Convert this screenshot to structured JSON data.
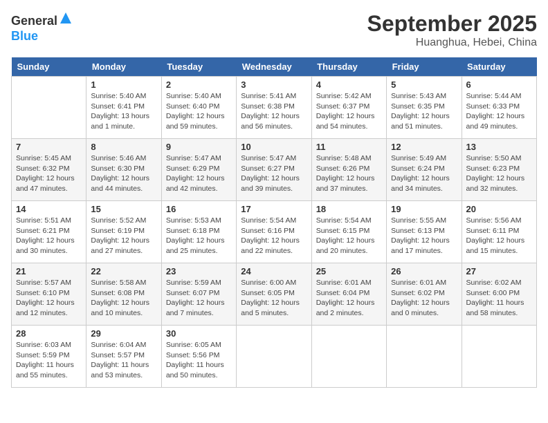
{
  "header": {
    "logo_general": "General",
    "logo_blue": "Blue",
    "month_title": "September 2025",
    "location": "Huanghua, Hebei, China"
  },
  "weekdays": [
    "Sunday",
    "Monday",
    "Tuesday",
    "Wednesday",
    "Thursday",
    "Friday",
    "Saturday"
  ],
  "weeks": [
    [
      {
        "day": "",
        "sunrise": "",
        "sunset": "",
        "daylight": ""
      },
      {
        "day": "1",
        "sunrise": "Sunrise: 5:40 AM",
        "sunset": "Sunset: 6:41 PM",
        "daylight": "Daylight: 13 hours and 1 minute."
      },
      {
        "day": "2",
        "sunrise": "Sunrise: 5:40 AM",
        "sunset": "Sunset: 6:40 PM",
        "daylight": "Daylight: 12 hours and 59 minutes."
      },
      {
        "day": "3",
        "sunrise": "Sunrise: 5:41 AM",
        "sunset": "Sunset: 6:38 PM",
        "daylight": "Daylight: 12 hours and 56 minutes."
      },
      {
        "day": "4",
        "sunrise": "Sunrise: 5:42 AM",
        "sunset": "Sunset: 6:37 PM",
        "daylight": "Daylight: 12 hours and 54 minutes."
      },
      {
        "day": "5",
        "sunrise": "Sunrise: 5:43 AM",
        "sunset": "Sunset: 6:35 PM",
        "daylight": "Daylight: 12 hours and 51 minutes."
      },
      {
        "day": "6",
        "sunrise": "Sunrise: 5:44 AM",
        "sunset": "Sunset: 6:33 PM",
        "daylight": "Daylight: 12 hours and 49 minutes."
      }
    ],
    [
      {
        "day": "7",
        "sunrise": "Sunrise: 5:45 AM",
        "sunset": "Sunset: 6:32 PM",
        "daylight": "Daylight: 12 hours and 47 minutes."
      },
      {
        "day": "8",
        "sunrise": "Sunrise: 5:46 AM",
        "sunset": "Sunset: 6:30 PM",
        "daylight": "Daylight: 12 hours and 44 minutes."
      },
      {
        "day": "9",
        "sunrise": "Sunrise: 5:47 AM",
        "sunset": "Sunset: 6:29 PM",
        "daylight": "Daylight: 12 hours and 42 minutes."
      },
      {
        "day": "10",
        "sunrise": "Sunrise: 5:47 AM",
        "sunset": "Sunset: 6:27 PM",
        "daylight": "Daylight: 12 hours and 39 minutes."
      },
      {
        "day": "11",
        "sunrise": "Sunrise: 5:48 AM",
        "sunset": "Sunset: 6:26 PM",
        "daylight": "Daylight: 12 hours and 37 minutes."
      },
      {
        "day": "12",
        "sunrise": "Sunrise: 5:49 AM",
        "sunset": "Sunset: 6:24 PM",
        "daylight": "Daylight: 12 hours and 34 minutes."
      },
      {
        "day": "13",
        "sunrise": "Sunrise: 5:50 AM",
        "sunset": "Sunset: 6:23 PM",
        "daylight": "Daylight: 12 hours and 32 minutes."
      }
    ],
    [
      {
        "day": "14",
        "sunrise": "Sunrise: 5:51 AM",
        "sunset": "Sunset: 6:21 PM",
        "daylight": "Daylight: 12 hours and 30 minutes."
      },
      {
        "day": "15",
        "sunrise": "Sunrise: 5:52 AM",
        "sunset": "Sunset: 6:19 PM",
        "daylight": "Daylight: 12 hours and 27 minutes."
      },
      {
        "day": "16",
        "sunrise": "Sunrise: 5:53 AM",
        "sunset": "Sunset: 6:18 PM",
        "daylight": "Daylight: 12 hours and 25 minutes."
      },
      {
        "day": "17",
        "sunrise": "Sunrise: 5:54 AM",
        "sunset": "Sunset: 6:16 PM",
        "daylight": "Daylight: 12 hours and 22 minutes."
      },
      {
        "day": "18",
        "sunrise": "Sunrise: 5:54 AM",
        "sunset": "Sunset: 6:15 PM",
        "daylight": "Daylight: 12 hours and 20 minutes."
      },
      {
        "day": "19",
        "sunrise": "Sunrise: 5:55 AM",
        "sunset": "Sunset: 6:13 PM",
        "daylight": "Daylight: 12 hours and 17 minutes."
      },
      {
        "day": "20",
        "sunrise": "Sunrise: 5:56 AM",
        "sunset": "Sunset: 6:11 PM",
        "daylight": "Daylight: 12 hours and 15 minutes."
      }
    ],
    [
      {
        "day": "21",
        "sunrise": "Sunrise: 5:57 AM",
        "sunset": "Sunset: 6:10 PM",
        "daylight": "Daylight: 12 hours and 12 minutes."
      },
      {
        "day": "22",
        "sunrise": "Sunrise: 5:58 AM",
        "sunset": "Sunset: 6:08 PM",
        "daylight": "Daylight: 12 hours and 10 minutes."
      },
      {
        "day": "23",
        "sunrise": "Sunrise: 5:59 AM",
        "sunset": "Sunset: 6:07 PM",
        "daylight": "Daylight: 12 hours and 7 minutes."
      },
      {
        "day": "24",
        "sunrise": "Sunrise: 6:00 AM",
        "sunset": "Sunset: 6:05 PM",
        "daylight": "Daylight: 12 hours and 5 minutes."
      },
      {
        "day": "25",
        "sunrise": "Sunrise: 6:01 AM",
        "sunset": "Sunset: 6:04 PM",
        "daylight": "Daylight: 12 hours and 2 minutes."
      },
      {
        "day": "26",
        "sunrise": "Sunrise: 6:01 AM",
        "sunset": "Sunset: 6:02 PM",
        "daylight": "Daylight: 12 hours and 0 minutes."
      },
      {
        "day": "27",
        "sunrise": "Sunrise: 6:02 AM",
        "sunset": "Sunset: 6:00 PM",
        "daylight": "Daylight: 11 hours and 58 minutes."
      }
    ],
    [
      {
        "day": "28",
        "sunrise": "Sunrise: 6:03 AM",
        "sunset": "Sunset: 5:59 PM",
        "daylight": "Daylight: 11 hours and 55 minutes."
      },
      {
        "day": "29",
        "sunrise": "Sunrise: 6:04 AM",
        "sunset": "Sunset: 5:57 PM",
        "daylight": "Daylight: 11 hours and 53 minutes."
      },
      {
        "day": "30",
        "sunrise": "Sunrise: 6:05 AM",
        "sunset": "Sunset: 5:56 PM",
        "daylight": "Daylight: 11 hours and 50 minutes."
      },
      {
        "day": "",
        "sunrise": "",
        "sunset": "",
        "daylight": ""
      },
      {
        "day": "",
        "sunrise": "",
        "sunset": "",
        "daylight": ""
      },
      {
        "day": "",
        "sunrise": "",
        "sunset": "",
        "daylight": ""
      },
      {
        "day": "",
        "sunrise": "",
        "sunset": "",
        "daylight": ""
      }
    ]
  ]
}
